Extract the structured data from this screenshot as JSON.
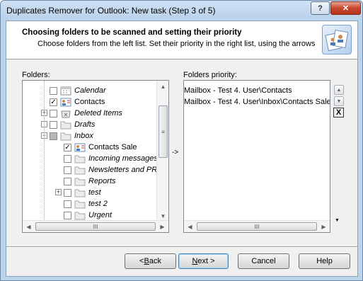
{
  "window": {
    "title": "Duplicates Remover for Outlook: New task (Step 3 of 5)",
    "help_label": "?",
    "close_label": "✕"
  },
  "header": {
    "title": "Choosing folders to be scanned and setting their priority",
    "subtitle": "Choose folders from the left list. Set their priority in the right list, using the arrows"
  },
  "folders_label": "Folders:",
  "priority_label": "Folders priority:",
  "move_arrow": "->",
  "tree": [
    {
      "text": "Calendar",
      "italic": true,
      "check": "",
      "expander": "",
      "icon": "calendar-icon"
    },
    {
      "text": "Contacts",
      "italic": false,
      "check": "✓",
      "expander": "",
      "icon": "contacts-icon"
    },
    {
      "text": "Deleted Items",
      "italic": true,
      "check": "",
      "expander": "+",
      "icon": "trash-icon"
    },
    {
      "text": "Drafts",
      "italic": true,
      "check": "",
      "expander": "",
      "icon": "folder-icon"
    },
    {
      "text": "Inbox",
      "italic": true,
      "check": "filled",
      "expander": "−",
      "icon": "folder-icon"
    },
    {
      "text": "Contacts Sale",
      "italic": false,
      "check": "✓",
      "expander": "",
      "icon": "contacts-icon"
    },
    {
      "text": "Incoming messages",
      "italic": true,
      "check": "",
      "expander": "",
      "icon": "folder-icon"
    },
    {
      "text": "Newsletters and PR",
      "italic": true,
      "check": "",
      "expander": "",
      "icon": "folder-icon"
    },
    {
      "text": "Reports",
      "italic": true,
      "check": "",
      "expander": "",
      "icon": "folder-icon"
    },
    {
      "text": "test",
      "italic": true,
      "check": "",
      "expander": "+",
      "icon": "folder-icon"
    },
    {
      "text": "test 2",
      "italic": true,
      "check": "",
      "expander": "",
      "icon": "folder-icon"
    },
    {
      "text": "Urgent",
      "italic": true,
      "check": "",
      "expander": "",
      "icon": "folder-icon"
    }
  ],
  "priority_list": [
    "Mailbox - Test 4. User\\Contacts",
    "Mailbox - Test 4. User\\Inbox\\Contacts Sale"
  ],
  "side_buttons": {
    "remove_label": "X"
  },
  "buttons": {
    "back": {
      "pre": "< ",
      "accel": "B",
      "post": "ack"
    },
    "next": {
      "pre": "",
      "accel": "N",
      "post": "ext >"
    },
    "cancel": "Cancel",
    "help": "Help"
  },
  "colors": {
    "accent": "#3c7fb1",
    "close": "#c7462c"
  }
}
